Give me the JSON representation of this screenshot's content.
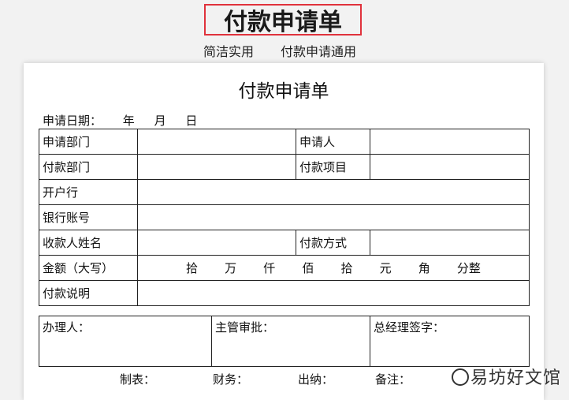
{
  "banner": {
    "title": "付款申请单",
    "sub_left": "简洁实用",
    "sub_right": "付款申请通用"
  },
  "form": {
    "title": "付款申请单",
    "date_label": "申请日期：",
    "date_year": "年",
    "date_month": "月",
    "date_day": "日",
    "rows": {
      "dept": "申请部门",
      "applicant": "申请人",
      "pay_dept": "付款部门",
      "pay_item": "付款项目",
      "bank": "开户行",
      "account": "银行账号",
      "payee": "收款人姓名",
      "pay_method": "付款方式",
      "amount": "金额（大写）",
      "description": "付款说明"
    },
    "amount_units": [
      "拾",
      "万",
      "仟",
      "佰",
      "拾",
      "元",
      "角",
      "分整"
    ],
    "sign": {
      "handler": "办理人：",
      "supervisor": "主管审批：",
      "gm": "总经理签字："
    },
    "footer": {
      "maker": "制表：",
      "finance": "财务：",
      "cashier": "出纳：",
      "remark": "备注："
    }
  },
  "watermark": "易坊好文馆"
}
